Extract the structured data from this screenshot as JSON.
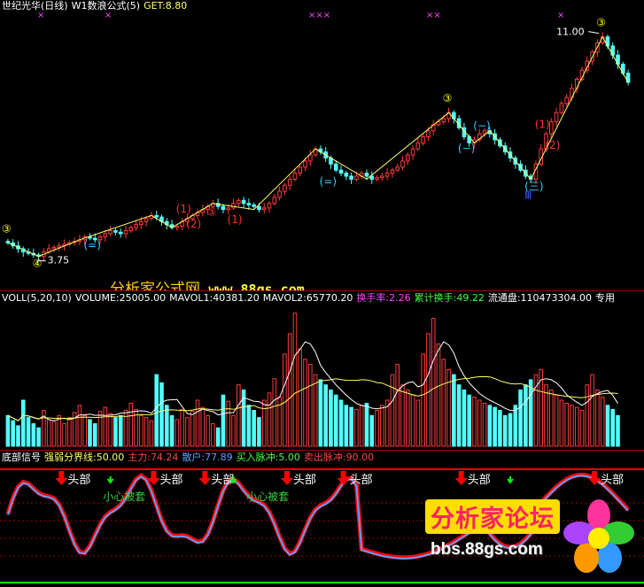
{
  "colors": {
    "background": "#000000",
    "up_bar": "#ff3b3b",
    "down_bar": "#54ffff",
    "wave_line": "#ffff66",
    "mark_yellow": "#ffff00",
    "mark_red": "#ff3030",
    "mark_cyan": "#33ccff",
    "magenta": "#ff44ff",
    "grid_red": "#a00000",
    "ma_white": "#ffffff",
    "ma_yellow": "#ffff66",
    "signal_red": "#ff0000",
    "signal_blue": "#5aa0ff",
    "green": "#00ff00"
  },
  "price_panel": {
    "header": {
      "stock": "世纪光华(日线)",
      "formula": "W1数浪公式(5)",
      "get_label": "GET:",
      "get_value": "8.80"
    },
    "high_label": "11.00",
    "low_label": "3.75",
    "top_x_marks": [
      "×",
      "×",
      "×××",
      "××",
      "×"
    ],
    "wave_labels": [
      {
        "text": "③",
        "color": "yellow"
      },
      {
        "text": "④",
        "color": "yellow"
      },
      {
        "text": "(=)",
        "color": "cyan"
      },
      {
        "text": "(1)",
        "color": "red"
      },
      {
        "text": "(2)",
        "color": "red"
      },
      {
        "text": "③",
        "color": "red"
      },
      {
        "text": "(1)",
        "color": "red"
      },
      {
        "text": "(=)",
        "color": "cyan"
      },
      {
        "text": "③",
        "color": "yellow"
      },
      {
        "text": "(−)",
        "color": "cyan"
      },
      {
        "text": "(−)",
        "color": "cyan"
      },
      {
        "text": "(三)",
        "color": "cyan"
      },
      {
        "text": "(1)",
        "color": "red"
      },
      {
        "text": "(2)",
        "color": "red"
      },
      {
        "text": "③",
        "color": "yellow"
      },
      {
        "text": "Ⅲ",
        "color": "blue"
      }
    ],
    "watermark": {
      "brand": "分析家公式网",
      "url": "www.88gs.com"
    }
  },
  "volume_panel": {
    "items": [
      {
        "label": "VOLL(5,20,10)",
        "value": "",
        "color": "#ffffff"
      },
      {
        "label": "VOLUME:",
        "value": "25005.00",
        "color": "#ffffff"
      },
      {
        "label": "MAVOL1:",
        "value": "40381.20",
        "color": "#ffffff"
      },
      {
        "label": "MAVOL2:",
        "value": "65770.20",
        "color": "#ffffff"
      },
      {
        "label": "换手率:",
        "value": "2.26",
        "color": "#ff44ff"
      },
      {
        "label": "累计换手:",
        "value": "49.22",
        "color": "#44ff44"
      },
      {
        "label": "流通盘:",
        "value": "110473304.00",
        "color": "#ffffff"
      },
      {
        "label": "专用",
        "value": "",
        "color": "#ffffff"
      }
    ]
  },
  "signal_panel": {
    "items": [
      {
        "label": "底部信号",
        "value": "",
        "color": "#ffffff"
      },
      {
        "label": "强弱分界线:",
        "value": "50.00",
        "color": "#ffff66"
      },
      {
        "label": "主力:",
        "value": "74.24",
        "color": "#ff4444"
      },
      {
        "label": "散户:",
        "value": "77.89",
        "color": "#5aa0ff"
      },
      {
        "label": "买入脉冲:",
        "value": "5.00",
        "color": "#44ff44"
      },
      {
        "label": "卖出脉冲:",
        "value": "90.00",
        "color": "#ff4444"
      }
    ],
    "head_label": "头部",
    "caution_label": "小心被套",
    "forum_watermark": {
      "title": "分析家论坛",
      "url": "bbs.88gs.com"
    }
  },
  "chart_data": [
    {
      "type": "candlestick",
      "title": "世纪光华(日线) W1数浪公式(5)",
      "xlabel": "",
      "ylabel": "",
      "ylim": [
        3.3,
        11.4
      ],
      "annotations": [
        "11.00",
        "3.75"
      ],
      "close": [
        4.2,
        4.1,
        4.0,
        3.9,
        3.85,
        3.8,
        3.75,
        3.9,
        4.0,
        4.05,
        4.1,
        4.15,
        4.2,
        4.25,
        4.3,
        4.4,
        4.35,
        4.3,
        4.4,
        4.5,
        4.6,
        4.55,
        4.5,
        4.6,
        4.7,
        4.8,
        4.9,
        5.0,
        5.1,
        5.05,
        4.9,
        4.8,
        4.7,
        4.75,
        4.9,
        5.0,
        5.1,
        5.2,
        5.3,
        5.4,
        5.5,
        5.4,
        5.3,
        5.35,
        5.5,
        5.6,
        5.5,
        5.45,
        5.4,
        5.3,
        5.35,
        5.5,
        5.7,
        5.9,
        6.1,
        6.3,
        6.5,
        6.7,
        6.9,
        7.1,
        7.3,
        7.2,
        7.0,
        6.8,
        6.6,
        6.5,
        6.4,
        6.3,
        6.4,
        6.5,
        6.4,
        6.3,
        6.35,
        6.4,
        6.5,
        6.6,
        6.7,
        6.9,
        7.1,
        7.3,
        7.5,
        7.7,
        7.9,
        8.1,
        8.2,
        8.3,
        8.5,
        8.3,
        8.0,
        7.7,
        7.5,
        7.6,
        7.8,
        7.9,
        7.8,
        7.6,
        7.4,
        7.2,
        7.0,
        6.8,
        6.6,
        6.4,
        6.3,
        6.8,
        7.3,
        7.8,
        8.2,
        8.5,
        8.8,
        9.0,
        9.3,
        9.6,
        9.9,
        10.2,
        10.5,
        10.8,
        11.0,
        10.7,
        10.4,
        10.1,
        9.8,
        9.5
      ],
      "volume": [
        30,
        25,
        20,
        45,
        28,
        22,
        18,
        35,
        26,
        24,
        30,
        22,
        28,
        33,
        40,
        30,
        26,
        22,
        34,
        38,
        32,
        28,
        30,
        35,
        42,
        36,
        30,
        28,
        25,
        70,
        62,
        40,
        30,
        26,
        36,
        28,
        34,
        45,
        38,
        30,
        22,
        18,
        50,
        44,
        30,
        60,
        55,
        40,
        35,
        28,
        45,
        52,
        66,
        48,
        90,
        110,
        130,
        95,
        85,
        80,
        70,
        65,
        60,
        55,
        50,
        45,
        40,
        38,
        36,
        40,
        42,
        30,
        35,
        40,
        45,
        70,
        80,
        60,
        55,
        50,
        45,
        90,
        110,
        125,
        100,
        85,
        75,
        70,
        60,
        55,
        50,
        48,
        45,
        42,
        40,
        38,
        35,
        30,
        32,
        40,
        55,
        60,
        65,
        70,
        75,
        60,
        55,
        50,
        45,
        42,
        40,
        38,
        35,
        60,
        70,
        55,
        48,
        40,
        36,
        30
      ]
    }
  ]
}
